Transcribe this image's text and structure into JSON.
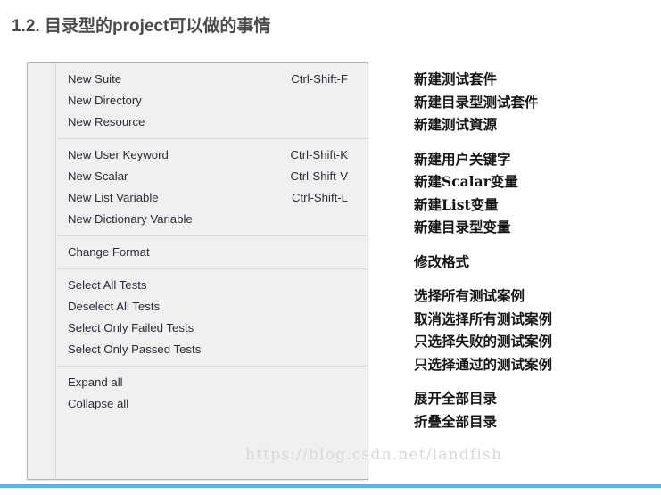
{
  "page": {
    "title": "1.2. 目录型的project可以做的事情",
    "title_color": "#4a4a4a",
    "watermark": "https://blog.csdn.net/landfish",
    "accent_color": "#4dbce9",
    "rule_color": "#9a9a9a"
  },
  "context_menu": {
    "background": "#f0f0f0",
    "border_color": "#b4b4b4",
    "text_color": "#2b2b38",
    "groups": [
      {
        "items": [
          {
            "label": "New Suite",
            "shortcut": "Ctrl-Shift-F"
          },
          {
            "label": "New Directory",
            "shortcut": ""
          },
          {
            "label": "New Resource",
            "shortcut": ""
          }
        ]
      },
      {
        "items": [
          {
            "label": "New User Keyword",
            "shortcut": "Ctrl-Shift-K"
          },
          {
            "label": "New Scalar",
            "shortcut": "Ctrl-Shift-V"
          },
          {
            "label": "New List Variable",
            "shortcut": "Ctrl-Shift-L"
          },
          {
            "label": "New Dictionary Variable",
            "shortcut": ""
          }
        ]
      },
      {
        "items": [
          {
            "label": "Change Format",
            "shortcut": ""
          }
        ]
      },
      {
        "items": [
          {
            "label": "Select All Tests",
            "shortcut": ""
          },
          {
            "label": "Deselect All Tests",
            "shortcut": ""
          },
          {
            "label": "Select Only Failed Tests",
            "shortcut": ""
          },
          {
            "label": "Select Only Passed Tests",
            "shortcut": ""
          }
        ]
      },
      {
        "items": [
          {
            "label": "Expand all",
            "shortcut": ""
          },
          {
            "label": "Collapse all",
            "shortcut": ""
          }
        ]
      }
    ]
  },
  "annotations": {
    "groups": [
      {
        "lines": [
          "新建测试套件",
          "新建目录型测试套件",
          "新建测试資源"
        ]
      },
      {
        "lines": [
          "新建用户关键字",
          "新建Scalar变量",
          "新建List变量",
          "新建目录型变量"
        ]
      },
      {
        "lines": [
          "修改格式"
        ]
      },
      {
        "lines": [
          "选择所有测试案例",
          "取消选择所有测试案例",
          "只选择失败的测试案例",
          "只选择通过的测试案例"
        ]
      },
      {
        "lines": [
          "展开全部目录",
          "折叠全部目录"
        ]
      }
    ]
  }
}
